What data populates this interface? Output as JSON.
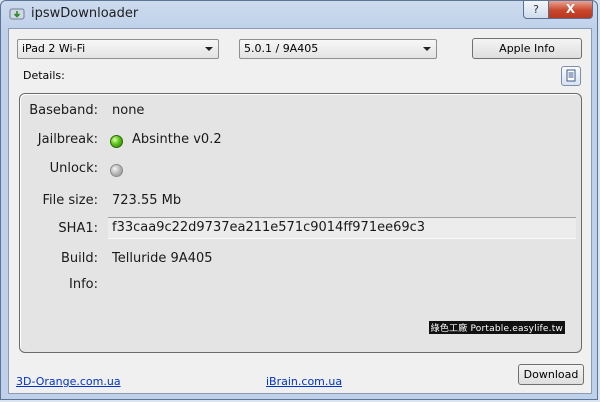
{
  "window": {
    "title": "ipswDownloader",
    "help_label": "?",
    "close_label": "X"
  },
  "toolbar": {
    "device_select": "iPad 2 Wi-Fi",
    "firmware_select": "5.0.1 / 9A405",
    "apple_info_label": "Apple Info",
    "details_label": "Details:"
  },
  "details": {
    "baseband_label": "Baseband:",
    "baseband_value": "none",
    "jailbreak_label": "Jailbreak:",
    "jailbreak_value": "Absinthe v0.2",
    "unlock_label": "Unlock:",
    "filesize_label": "File size:",
    "filesize_value": "723.55 Mb",
    "sha1_label": "SHA1:",
    "sha1_value": "f33caa9c22d9737ea211e571c9014ff971ee69c3",
    "build_label": "Build:",
    "build_value": "Telluride 9A405",
    "info_label": "Info:",
    "watermark": "綠色工廠 Portable.easylife.tw"
  },
  "footer": {
    "link1": "3D-Orange.com.ua",
    "link2": "iBrain.com.ua",
    "download_label": "Download"
  },
  "colors": {
    "jailbreak_status": "#5cc21b",
    "unlock_status": "#b7b7b7",
    "link": "#0033cc"
  }
}
